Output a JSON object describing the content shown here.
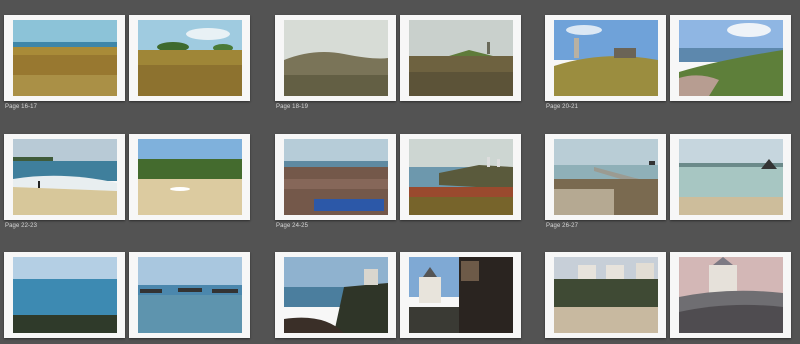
{
  "colors": {
    "canvas_background": "#535353",
    "page_paper": "#f7f7f7",
    "label_text": "#d6d6d6"
  },
  "spreads": [
    {
      "label": "Page 16-17",
      "photos": [
        "coastal-heath-sea-view",
        "heath-with-trees"
      ]
    },
    {
      "label": "Page 18-19",
      "photos": [
        "hilltop-grass-misty-sky",
        "rocky-headland-tower"
      ]
    },
    {
      "label": "Page 20-21",
      "photos": [
        "hill-with-chapel-ruin",
        "bay-view-blue-sky"
      ]
    },
    {
      "label": "Page 22-23",
      "photos": [
        "beach-surf-walker",
        "beach-with-boat"
      ]
    },
    {
      "label": "Page 24-25",
      "photos": [
        "tide-pools-rocky-shore",
        "cliff-with-towers"
      ]
    },
    {
      "label": "Page 26-27",
      "photos": [
        "jetty-low-tide",
        "tidal-flat-sculpture"
      ]
    },
    {
      "label": "",
      "photos": [
        "calm-sea-horizon",
        "terrace-benches-sea"
      ]
    },
    {
      "label": "",
      "photos": [
        "coast-villa-on-rocks",
        "villa-and-stone-wall"
      ]
    },
    {
      "label": "",
      "photos": [
        "seafront-houses-beach",
        "villa-on-rocks"
      ]
    }
  ]
}
